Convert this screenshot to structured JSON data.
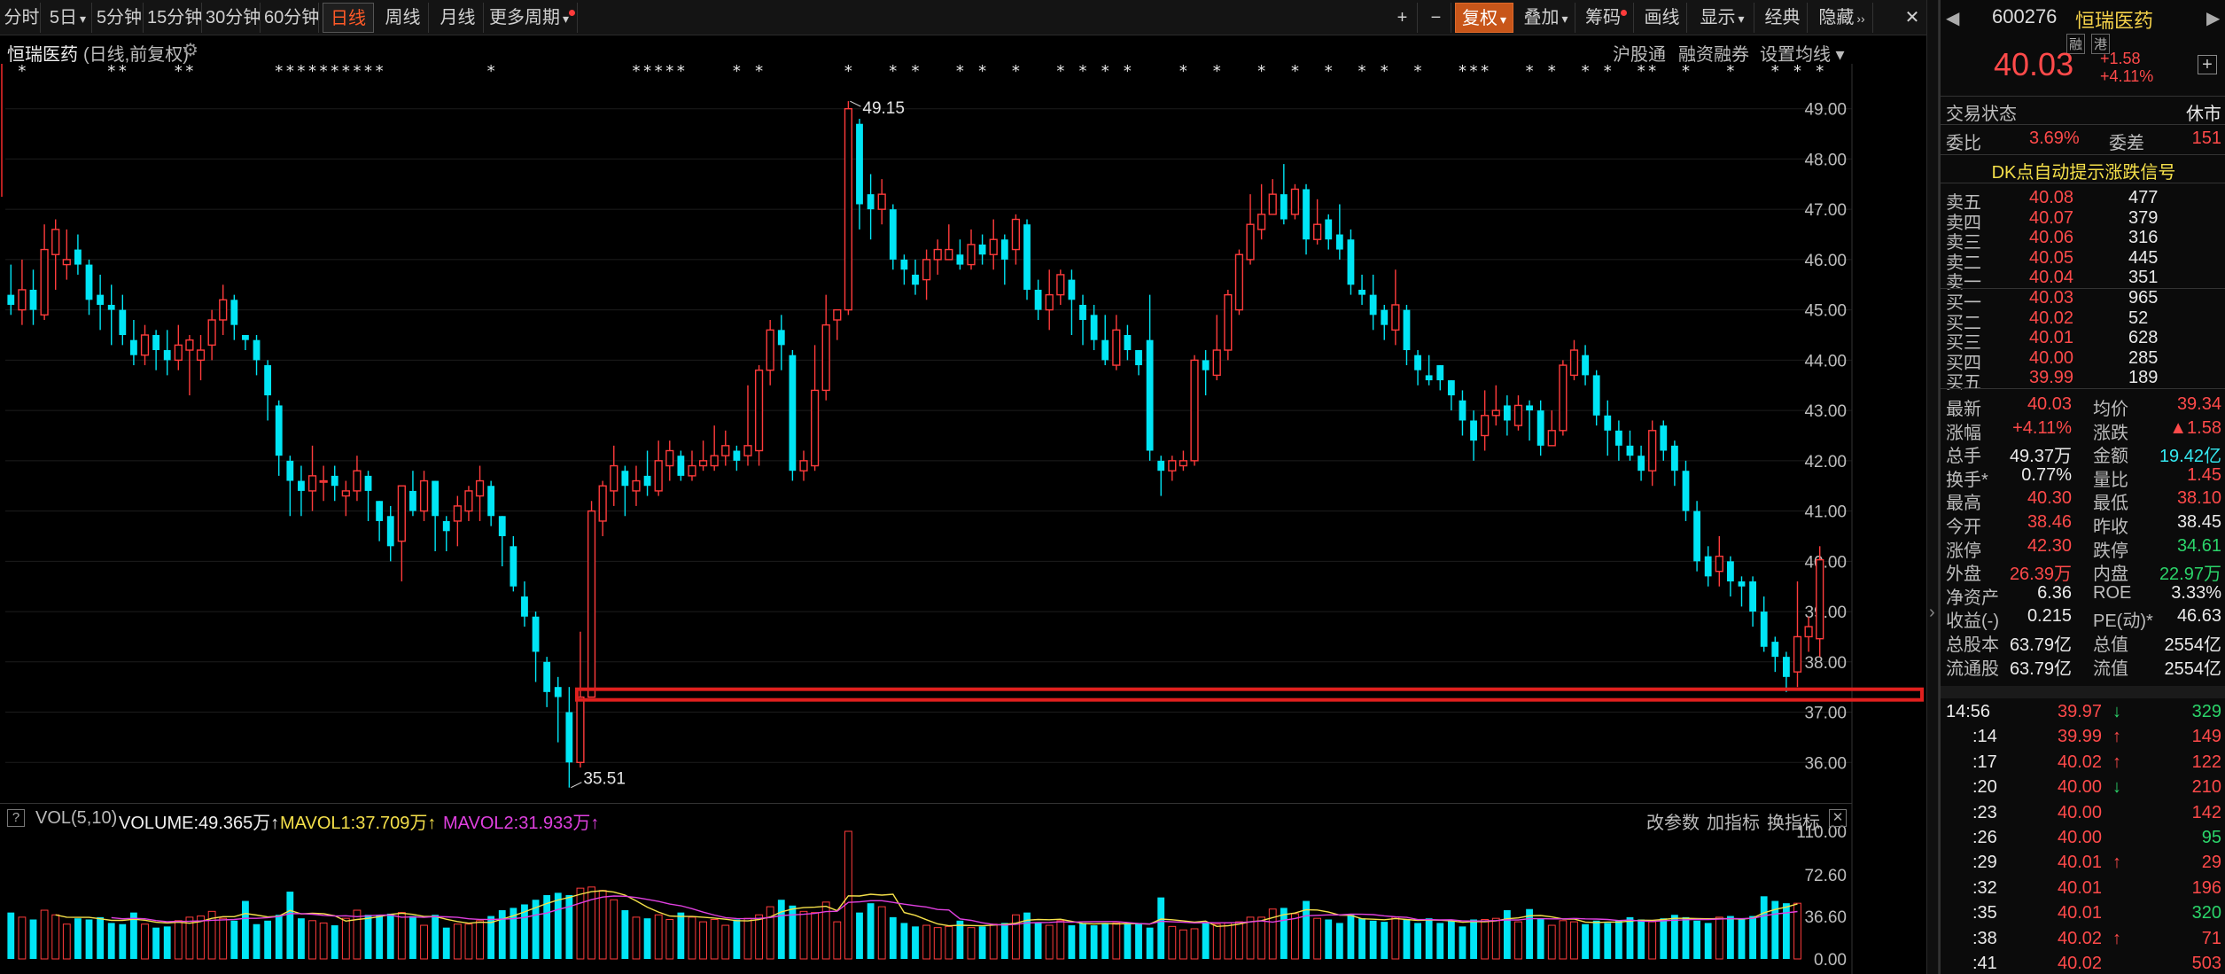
{
  "toolbar": {
    "left": [
      {
        "label": "分时"
      },
      {
        "label": "5日",
        "chev": "▾"
      },
      {
        "label": "5分钟"
      },
      {
        "label": "15分钟"
      },
      {
        "label": "30分钟"
      },
      {
        "label": "60分钟"
      },
      {
        "label": "日线",
        "active": true
      },
      {
        "label": "周线"
      },
      {
        "label": "月线"
      },
      {
        "label": "更多周期",
        "chev": "▾",
        "dot": true
      }
    ],
    "right": [
      {
        "label": "+"
      },
      {
        "label": "−"
      },
      {
        "label": "复权",
        "chev": "▾",
        "warm": true
      },
      {
        "label": "叠加",
        "chev": "▾"
      },
      {
        "label": "筹码",
        "dot": true
      },
      {
        "label": "画线"
      },
      {
        "label": "显示",
        "chev": "▾"
      },
      {
        "label": "经典"
      },
      {
        "label": "隐藏",
        "chev": "››"
      }
    ],
    "close_icon": "✕"
  },
  "chart_header": {
    "name": "恒瑞医药",
    "mode": "(日线,前复权)",
    "gear": "⚙",
    "links": [
      "沪股通",
      "融资融券",
      "设置均线 ▾"
    ]
  },
  "volume_header": {
    "help": "?",
    "indicator": "VOL(5,10)",
    "volume": "VOLUME:49.365万↑",
    "mavol1": "MAVOL1:37.709万↑",
    "mavol2": "MAVOL2:31.933万↑",
    "actions": [
      "改参数",
      "加指标",
      "换指标"
    ],
    "close": "✕"
  },
  "chart_data": {
    "type": "candlestick",
    "y_ticks": [
      "49.00",
      "48.00",
      "47.00",
      "46.00",
      "45.00",
      "44.00",
      "43.00",
      "42.00",
      "41.00",
      "40.00",
      "39.00",
      "38.00",
      "37.00",
      "36.00"
    ],
    "ylim": [
      35.3,
      49.4
    ],
    "high_label": "49.15",
    "low_label": "35.51",
    "support_line": 37.35,
    "vol_ticks": [
      "110.00",
      "72.60",
      "36.60",
      "0.00"
    ],
    "vol_ylim": [
      0,
      110
    ],
    "candles": [
      [
        45.3,
        45.1,
        45.9,
        44.9
      ],
      [
        45.0,
        45.4,
        46.0,
        44.7
      ],
      [
        45.4,
        45.0,
        45.8,
        44.7
      ],
      [
        44.9,
        46.2,
        46.7,
        44.8
      ],
      [
        46.1,
        46.6,
        46.8,
        45.4
      ],
      [
        45.9,
        46.0,
        46.6,
        45.6
      ],
      [
        46.2,
        45.9,
        46.5,
        45.7
      ],
      [
        45.9,
        45.2,
        46.0,
        44.9
      ],
      [
        45.3,
        45.1,
        45.7,
        44.6
      ],
      [
        45.1,
        45.0,
        45.5,
        44.3
      ],
      [
        45.0,
        44.5,
        45.3,
        44.3
      ],
      [
        44.4,
        44.1,
        44.8,
        43.9
      ],
      [
        44.1,
        44.5,
        44.7,
        43.9
      ],
      [
        44.5,
        44.2,
        44.6,
        43.8
      ],
      [
        44.2,
        44.0,
        44.6,
        43.7
      ],
      [
        44.0,
        44.3,
        44.7,
        43.8
      ],
      [
        44.2,
        44.4,
        44.5,
        43.3
      ],
      [
        44.0,
        44.2,
        44.5,
        43.6
      ],
      [
        44.3,
        44.8,
        45.0,
        44.0
      ],
      [
        44.8,
        45.2,
        45.5,
        44.5
      ],
      [
        45.2,
        44.7,
        45.3,
        44.4
      ],
      [
        44.5,
        44.4,
        44.5,
        44.2
      ],
      [
        44.4,
        44.0,
        44.5,
        43.7
      ],
      [
        43.9,
        43.3,
        44.0,
        42.8
      ],
      [
        43.1,
        42.1,
        43.2,
        41.7
      ],
      [
        42.0,
        41.6,
        42.1,
        40.9
      ],
      [
        41.6,
        41.4,
        41.9,
        40.9
      ],
      [
        41.4,
        41.7,
        42.3,
        41.0
      ],
      [
        41.6,
        41.6,
        41.9,
        41.2
      ],
      [
        41.7,
        41.5,
        41.9,
        41.2
      ],
      [
        41.3,
        41.4,
        41.6,
        40.9
      ],
      [
        41.4,
        41.8,
        42.1,
        41.2
      ],
      [
        41.7,
        41.4,
        41.8,
        40.8
      ],
      [
        41.2,
        40.8,
        41.2,
        40.4
      ],
      [
        40.9,
        40.3,
        41.1,
        40.0
      ],
      [
        40.4,
        41.5,
        41.5,
        39.6
      ],
      [
        41.4,
        41.0,
        41.8,
        40.9
      ],
      [
        41.0,
        41.6,
        41.8,
        40.8
      ],
      [
        41.6,
        40.9,
        41.6,
        40.2
      ],
      [
        40.8,
        40.6,
        40.9,
        40.2
      ],
      [
        40.8,
        41.1,
        41.3,
        40.3
      ],
      [
        41.0,
        41.4,
        41.5,
        40.8
      ],
      [
        41.3,
        41.6,
        41.9,
        40.8
      ],
      [
        41.5,
        40.9,
        41.6,
        40.7
      ],
      [
        40.9,
        40.5,
        40.9,
        39.9
      ],
      [
        40.3,
        39.5,
        40.5,
        39.4
      ],
      [
        39.3,
        38.9,
        39.6,
        38.7
      ],
      [
        38.9,
        38.2,
        39.0,
        37.6
      ],
      [
        38.0,
        37.4,
        38.1,
        37.1
      ],
      [
        37.5,
        37.3,
        37.7,
        36.4
      ],
      [
        37.0,
        36.0,
        37.5,
        35.5
      ],
      [
        36.0,
        37.3,
        38.6,
        35.9
      ],
      [
        37.3,
        41.0,
        41.2,
        37.3
      ],
      [
        40.8,
        41.5,
        41.6,
        40.5
      ],
      [
        41.4,
        41.9,
        42.3,
        41.1
      ],
      [
        41.8,
        41.5,
        41.9,
        40.9
      ],
      [
        41.4,
        41.6,
        41.9,
        41.1
      ],
      [
        41.7,
        41.5,
        42.2,
        41.3
      ],
      [
        41.4,
        42.0,
        42.4,
        41.3
      ],
      [
        41.9,
        42.2,
        42.4,
        41.6
      ],
      [
        42.1,
        41.7,
        42.2,
        41.6
      ],
      [
        41.7,
        41.9,
        42.2,
        41.6
      ],
      [
        41.9,
        42.0,
        42.4,
        41.8
      ],
      [
        41.9,
        42.1,
        42.7,
        41.8
      ],
      [
        42.1,
        42.3,
        42.6,
        41.9
      ],
      [
        42.2,
        42.0,
        42.3,
        41.8
      ],
      [
        42.1,
        42.3,
        43.5,
        41.9
      ],
      [
        42.2,
        43.8,
        43.9,
        41.9
      ],
      [
        43.8,
        44.6,
        44.8,
        43.5
      ],
      [
        44.6,
        44.3,
        44.9,
        43.8
      ],
      [
        44.1,
        41.8,
        44.2,
        41.6
      ],
      [
        41.8,
        42.0,
        42.2,
        41.6
      ],
      [
        41.9,
        43.4,
        44.3,
        41.8
      ],
      [
        43.4,
        44.7,
        45.3,
        43.2
      ],
      [
        44.8,
        45.0,
        45.0,
        44.4
      ],
      [
        45.0,
        49.0,
        49.15,
        44.9
      ],
      [
        48.7,
        47.1,
        48.8,
        46.6
      ],
      [
        47.3,
        47.0,
        47.7,
        46.4
      ],
      [
        47.0,
        47.3,
        47.6,
        46.7
      ],
      [
        47.0,
        46.0,
        47.1,
        45.8
      ],
      [
        46.0,
        45.8,
        46.1,
        45.5
      ],
      [
        45.7,
        45.5,
        46.0,
        45.3
      ],
      [
        45.6,
        46.0,
        46.2,
        45.2
      ],
      [
        46.0,
        46.2,
        46.4,
        45.7
      ],
      [
        46.0,
        46.2,
        46.7,
        46.0
      ],
      [
        46.1,
        45.9,
        46.4,
        45.8
      ],
      [
        45.9,
        46.3,
        46.6,
        45.8
      ],
      [
        46.3,
        46.1,
        46.5,
        45.9
      ],
      [
        46.1,
        46.4,
        46.8,
        45.8
      ],
      [
        46.4,
        46.0,
        46.5,
        45.5
      ],
      [
        46.2,
        46.8,
        46.9,
        45.9
      ],
      [
        46.7,
        45.4,
        46.8,
        45.2
      ],
      [
        45.4,
        45.0,
        45.6,
        44.8
      ],
      [
        45.0,
        45.3,
        45.8,
        44.6
      ],
      [
        45.3,
        45.7,
        45.8,
        45.1
      ],
      [
        45.6,
        45.2,
        45.8,
        44.5
      ],
      [
        45.1,
        44.8,
        45.3,
        44.3
      ],
      [
        44.9,
        44.4,
        45.1,
        44.2
      ],
      [
        44.4,
        44.0,
        44.9,
        43.9
      ],
      [
        43.9,
        44.6,
        44.9,
        43.8
      ],
      [
        44.5,
        44.2,
        44.7,
        44.0
      ],
      [
        44.2,
        43.9,
        44.2,
        43.7
      ],
      [
        44.4,
        42.2,
        45.3,
        42.0
      ],
      [
        42.0,
        41.8,
        42.1,
        41.3
      ],
      [
        41.8,
        42.0,
        42.1,
        41.6
      ],
      [
        41.9,
        42.0,
        42.2,
        41.8
      ],
      [
        42.0,
        44.0,
        44.1,
        41.9
      ],
      [
        44.0,
        43.8,
        44.2,
        43.3
      ],
      [
        43.7,
        44.2,
        44.9,
        43.6
      ],
      [
        44.2,
        45.3,
        45.4,
        44.0
      ],
      [
        45.0,
        46.1,
        46.2,
        44.9
      ],
      [
        46.0,
        46.7,
        47.3,
        45.9
      ],
      [
        46.6,
        46.9,
        47.5,
        46.4
      ],
      [
        46.9,
        47.3,
        47.6,
        47.1
      ],
      [
        47.3,
        46.8,
        47.9,
        46.7
      ],
      [
        46.9,
        47.4,
        47.5,
        46.8
      ],
      [
        47.4,
        46.4,
        47.5,
        46.1
      ],
      [
        46.4,
        46.7,
        47.2,
        46.3
      ],
      [
        46.8,
        46.4,
        46.9,
        46.2
      ],
      [
        46.5,
        46.2,
        47.1,
        46.0
      ],
      [
        46.4,
        45.5,
        46.6,
        45.3
      ],
      [
        45.4,
        45.3,
        45.7,
        45.1
      ],
      [
        45.3,
        44.9,
        45.7,
        44.6
      ],
      [
        45.0,
        44.7,
        45.1,
        44.4
      ],
      [
        44.6,
        45.1,
        45.8,
        44.3
      ],
      [
        45.0,
        44.2,
        45.1,
        43.9
      ],
      [
        44.1,
        43.8,
        44.2,
        43.5
      ],
      [
        43.7,
        43.6,
        44.1,
        43.5
      ],
      [
        43.9,
        43.6,
        43.9,
        43.4
      ],
      [
        43.6,
        43.3,
        43.6,
        43.0
      ],
      [
        43.2,
        42.8,
        43.4,
        42.5
      ],
      [
        42.8,
        42.4,
        43.0,
        42.0
      ],
      [
        42.5,
        42.9,
        43.4,
        42.2
      ],
      [
        42.9,
        43.0,
        43.5,
        42.7
      ],
      [
        43.1,
        42.8,
        43.3,
        42.5
      ],
      [
        42.7,
        43.1,
        43.3,
        42.6
      ],
      [
        43.1,
        43.0,
        43.2,
        42.4
      ],
      [
        43.0,
        42.3,
        43.2,
        42.1
      ],
      [
        42.3,
        42.6,
        43.0,
        42.3
      ],
      [
        42.6,
        43.9,
        44.0,
        42.5
      ],
      [
        43.7,
        44.2,
        44.4,
        43.6
      ],
      [
        44.1,
        43.7,
        44.3,
        43.5
      ],
      [
        43.7,
        42.9,
        43.8,
        42.7
      ],
      [
        42.9,
        42.6,
        43.2,
        42.1
      ],
      [
        42.6,
        42.3,
        42.8,
        42.0
      ],
      [
        42.3,
        42.1,
        42.6,
        42.0
      ],
      [
        42.1,
        41.8,
        42.3,
        41.6
      ],
      [
        41.8,
        42.6,
        42.8,
        41.5
      ],
      [
        42.7,
        42.2,
        42.8,
        42.0
      ],
      [
        42.3,
        41.8,
        42.4,
        41.5
      ],
      [
        41.8,
        41.0,
        42.0,
        40.8
      ],
      [
        41.0,
        40.0,
        41.2,
        39.8
      ],
      [
        40.1,
        39.7,
        40.3,
        39.5
      ],
      [
        39.8,
        40.1,
        40.5,
        39.5
      ],
      [
        40.0,
        39.6,
        40.1,
        39.3
      ],
      [
        39.6,
        39.5,
        39.7,
        39.1
      ],
      [
        39.6,
        39.0,
        39.7,
        38.7
      ],
      [
        39.0,
        38.3,
        39.3,
        38.2
      ],
      [
        38.4,
        38.1,
        38.5,
        37.8
      ],
      [
        38.1,
        37.7,
        38.2,
        37.4
      ],
      [
        37.8,
        38.5,
        39.6,
        37.5
      ],
      [
        38.5,
        38.7,
        38.9,
        38.2
      ],
      [
        38.46,
        40.03,
        40.3,
        38.1
      ]
    ],
    "vol": [
      40,
      36,
      34,
      42,
      38,
      30,
      35,
      34,
      36,
      31,
      30,
      40,
      30,
      27,
      28,
      33,
      36,
      37,
      41,
      35,
      33,
      50,
      30,
      33,
      38,
      58,
      35,
      33,
      31,
      29,
      35,
      42,
      38,
      38,
      39,
      40,
      37,
      29,
      38,
      27,
      30,
      30,
      33,
      37,
      42,
      44,
      47,
      51,
      55,
      57,
      55,
      61,
      62,
      59,
      51,
      42,
      36,
      35,
      38,
      34,
      40,
      36,
      32,
      34,
      29,
      34,
      35,
      38,
      45,
      51,
      46,
      41,
      40,
      49,
      32,
      110,
      40,
      48,
      45,
      36,
      31,
      28,
      29,
      27,
      28,
      33,
      27,
      28,
      30,
      31,
      38,
      40,
      31,
      29,
      33,
      29,
      31,
      29,
      31,
      31,
      30,
      31,
      27,
      53,
      28,
      25,
      26,
      31,
      30,
      31,
      32,
      36,
      36,
      43,
      44,
      39,
      50,
      35,
      34,
      31,
      38,
      35,
      33,
      32,
      36,
      34,
      31,
      35,
      31,
      33,
      28,
      34,
      34,
      35,
      42,
      32,
      43,
      35,
      29,
      33,
      32,
      30,
      33,
      31,
      33,
      36,
      34,
      32,
      35,
      38,
      36,
      33,
      31,
      36,
      37,
      35,
      37,
      54,
      50,
      48,
      48
    ]
  },
  "quote": {
    "code": "600276",
    "name": "恒瑞医药",
    "badge1": "融",
    "badge2": "港",
    "price": "40.03",
    "change": "+1.58",
    "pct": "+4.11%",
    "status_label": "交易状态",
    "status": "休市",
    "wb_label": "委比",
    "wb": "3.69%",
    "wc_label": "委差",
    "wc": "151",
    "signal": "DK点自动提示涨跌信号",
    "sells": [
      {
        "l": "卖五",
        "p": "40.08",
        "v": "477"
      },
      {
        "l": "卖四",
        "p": "40.07",
        "v": "379"
      },
      {
        "l": "卖三",
        "p": "40.06",
        "v": "316"
      },
      {
        "l": "卖二",
        "p": "40.05",
        "v": "445"
      },
      {
        "l": "卖一",
        "p": "40.04",
        "v": "351"
      }
    ],
    "buys": [
      {
        "l": "买一",
        "p": "40.03",
        "v": "965"
      },
      {
        "l": "买二",
        "p": "40.02",
        "v": "52"
      },
      {
        "l": "买三",
        "p": "40.01",
        "v": "628"
      },
      {
        "l": "买四",
        "p": "40.00",
        "v": "285"
      },
      {
        "l": "买五",
        "p": "39.99",
        "v": "189"
      }
    ],
    "stats": [
      {
        "l1": "最新",
        "v1": "40.03",
        "c1": "red",
        "l2": "均价",
        "v2": "39.34",
        "c2": "red"
      },
      {
        "l1": "涨幅",
        "v1": "+4.11%",
        "c1": "red",
        "l2": "涨跌",
        "v2": "▲1.58",
        "c2": "red"
      },
      {
        "l1": "总手",
        "v1": "49.37万",
        "c1": "white",
        "l2": "金额",
        "v2": "19.42亿",
        "c2": "cyan"
      },
      {
        "l1": "换手*",
        "v1": "0.77%",
        "c1": "white",
        "l2": "量比",
        "v2": "1.45",
        "c2": "red"
      },
      {
        "l1": "最高",
        "v1": "40.30",
        "c1": "red",
        "l2": "最低",
        "v2": "38.10",
        "c2": "red"
      },
      {
        "l1": "今开",
        "v1": "38.46",
        "c1": "red",
        "l2": "昨收",
        "v2": "38.45",
        "c2": "white"
      },
      {
        "l1": "涨停",
        "v1": "42.30",
        "c1": "red",
        "l2": "跌停",
        "v2": "34.61",
        "c2": "green"
      },
      {
        "l1": "外盘",
        "v1": "26.39万",
        "c1": "red",
        "l2": "内盘",
        "v2": "22.97万",
        "c2": "green"
      },
      {
        "l1": "净资产",
        "v1": "6.36",
        "c1": "white",
        "l2": "ROE",
        "v2": "3.33%",
        "c2": "white"
      },
      {
        "l1": "收益(-)",
        "v1": "0.215",
        "c1": "white",
        "l2": "PE(动)*",
        "v2": "46.63",
        "c2": "white"
      },
      {
        "l1": "总股本",
        "v1": "63.79亿",
        "c1": "white",
        "l2": "总值",
        "v2": "2554亿",
        "c2": "white"
      },
      {
        "l1": "流通股",
        "v1": "63.79亿",
        "c1": "white",
        "l2": "流值",
        "v2": "2554亿",
        "c2": "white"
      }
    ],
    "ticks": [
      {
        "t": "14:56",
        "p": "39.97",
        "a": "↓",
        "ac": "green",
        "v": "329",
        "vc": "green"
      },
      {
        "t": ":14",
        "p": "39.99",
        "a": "↑",
        "ac": "red",
        "v": "149",
        "vc": "red"
      },
      {
        "t": ":17",
        "p": "40.02",
        "a": "↑",
        "ac": "red",
        "v": "122",
        "vc": "red"
      },
      {
        "t": ":20",
        "p": "40.00",
        "a": "↓",
        "ac": "green",
        "v": "210",
        "vc": "red"
      },
      {
        "t": ":23",
        "p": "40.00",
        "a": "",
        "ac": "red",
        "v": "142",
        "vc": "red"
      },
      {
        "t": ":26",
        "p": "40.00",
        "a": "",
        "ac": "red",
        "v": "95",
        "vc": "green"
      },
      {
        "t": ":29",
        "p": "40.01",
        "a": "↑",
        "ac": "red",
        "v": "29",
        "vc": "red"
      },
      {
        "t": ":32",
        "p": "40.01",
        "a": "",
        "ac": "red",
        "v": "196",
        "vc": "red"
      },
      {
        "t": ":35",
        "p": "40.01",
        "a": "",
        "ac": "red",
        "v": "320",
        "vc": "green"
      },
      {
        "t": ":38",
        "p": "40.02",
        "a": "↑",
        "ac": "red",
        "v": "71",
        "vc": "red"
      },
      {
        "t": ":41",
        "p": "40.02",
        "a": "",
        "ac": "red",
        "v": "503",
        "vc": "red"
      }
    ]
  }
}
